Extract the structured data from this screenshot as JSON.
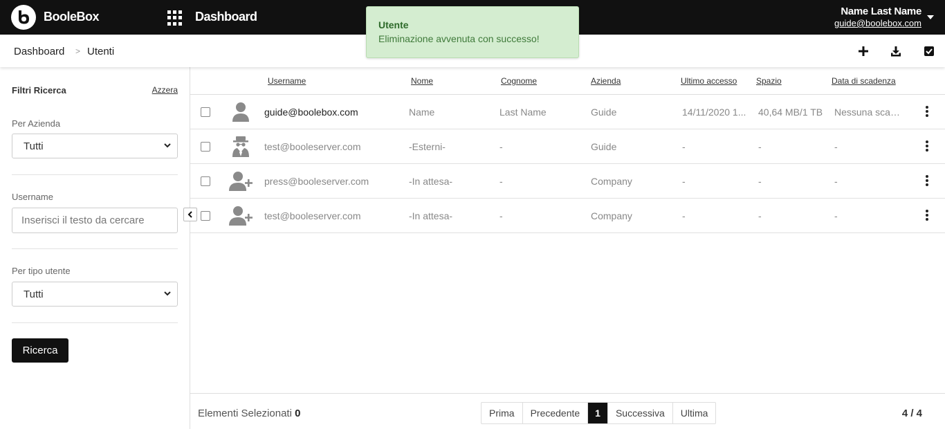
{
  "header": {
    "brand": "BooleBox",
    "title": "Dashboard",
    "user_name": "Name Last Name",
    "user_email": "guide@boolebox.com"
  },
  "toast": {
    "title": "Utente",
    "message": "Eliminazione avvenuta con successo!"
  },
  "breadcrumb": {
    "root": "Dashboard",
    "separator": ">",
    "current": "Utenti"
  },
  "filters": {
    "title": "Filtri Ricerca",
    "reset": "Azzera",
    "company_label": "Per Azienda",
    "company_value": "Tutti",
    "username_label": "Username",
    "username_placeholder": "Inserisci il testo da cercare",
    "usertype_label": "Per tipo utente",
    "usertype_value": "Tutti",
    "search_button": "Ricerca"
  },
  "table": {
    "columns": {
      "username": "Username",
      "name": "Nome",
      "surname": "Cognome",
      "company": "Azienda",
      "last_access": "Ultimo accesso",
      "space": "Spazio",
      "expiry": "Data di scadenza"
    },
    "rows": [
      {
        "avatar": "user-icon",
        "username": "guide@boolebox.com",
        "name": "Name",
        "surname": "Last Name",
        "company": "Guide",
        "last_access": "14/11/2020 1...",
        "space": "40,64 MB/1 TB",
        "expiry": "Nessuna scad..."
      },
      {
        "avatar": "spy-user-icon",
        "username": "test@booleserver.com",
        "name": "-Esterni-",
        "surname": "-",
        "company": "Guide",
        "last_access": "-",
        "space": "-",
        "expiry": "-"
      },
      {
        "avatar": "add-user-icon",
        "username": "press@booleserver.com",
        "name": "-In attesa-",
        "surname": "-",
        "company": "Company",
        "last_access": "-",
        "space": "-",
        "expiry": "-"
      },
      {
        "avatar": "add-user-icon",
        "username": "test@booleserver.com",
        "name": "-In attesa-",
        "surname": "-",
        "company": "Company",
        "last_access": "-",
        "space": "-",
        "expiry": "-"
      }
    ]
  },
  "footer": {
    "selected_label": "Elementi Selezionati",
    "selected_count": "0",
    "first": "Prima",
    "prev": "Precedente",
    "current_page": "1",
    "next": "Successiva",
    "last": "Ultima",
    "total": "4 / 4"
  },
  "colors": {
    "topbar": "#111111",
    "toast_bg": "#d4edd0",
    "toast_text": "#2e6a2a"
  }
}
